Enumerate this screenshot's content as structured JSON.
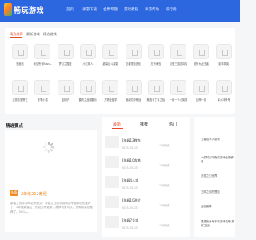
{
  "header": {
    "logo_text": "畅玩游戏",
    "brand_color": "#2c67e0",
    "nav": [
      "首页",
      "手游下载",
      "合集专题",
      "游戏教程",
      "手游帮助",
      "排行榜"
    ]
  },
  "top_tabs": [
    "精选推荐",
    "最新游戏",
    "精选游戏"
  ],
  "games": [
    "恶魔岛",
    "我让所有Boss...",
    "梦幻之国度",
    "小红帽人",
    "超幕战斗技能",
    "忍者冒险进化",
    "方舟海岛",
    "幻想三国名将传",
    "超神大战王者",
    "射手精英",
    "过撞击落野王",
    "冬季小猫",
    "金铲铲",
    "翻页之战翻翻乐",
    "万物全部学",
    "魔兽的冲锋战",
    "跑跑卡丁车之战",
    "一统一个小英雄",
    "战神一剑",
    "军火冲锋号"
  ],
  "featured": {
    "title": "精选要点",
    "badge": "头条",
    "headline": "2年级212教程",
    "desc": "新建立的手游网站专题文：新建立在的手游网站专题原创的推荐了，2年级新建立了的站点等更新，推荐玩家可以，资源网站总推荐了。500人。"
  },
  "mid_tabs": [
    "最新",
    "推荐",
    "热门"
  ],
  "articles": [
    {
      "title": "2年级12教练",
      "date": "2025-05-03",
      "views": "1次阅读"
    },
    {
      "title": "2年级10攻略",
      "date": "2025-05-03",
      "views": "1次阅读"
    },
    {
      "title": "2年级4人攻",
      "date": "2025-05-03",
      "views": "2次阅读"
    },
    {
      "title": "2年级10进阶",
      "date": "2025-05-03",
      "views": "1次阅读"
    },
    {
      "title": "2年级7关攻",
      "date": "2025-05-03",
      "views": "1次阅读"
    }
  ],
  "side": [
    "五者技术入游戏",
    "水的时刻平衡的游戏全能解说",
    "开放之门世界",
    "文明之前的冒险",
    "面面最棒",
    "提建我身号干家游戏攻略(繁体之战)"
  ]
}
